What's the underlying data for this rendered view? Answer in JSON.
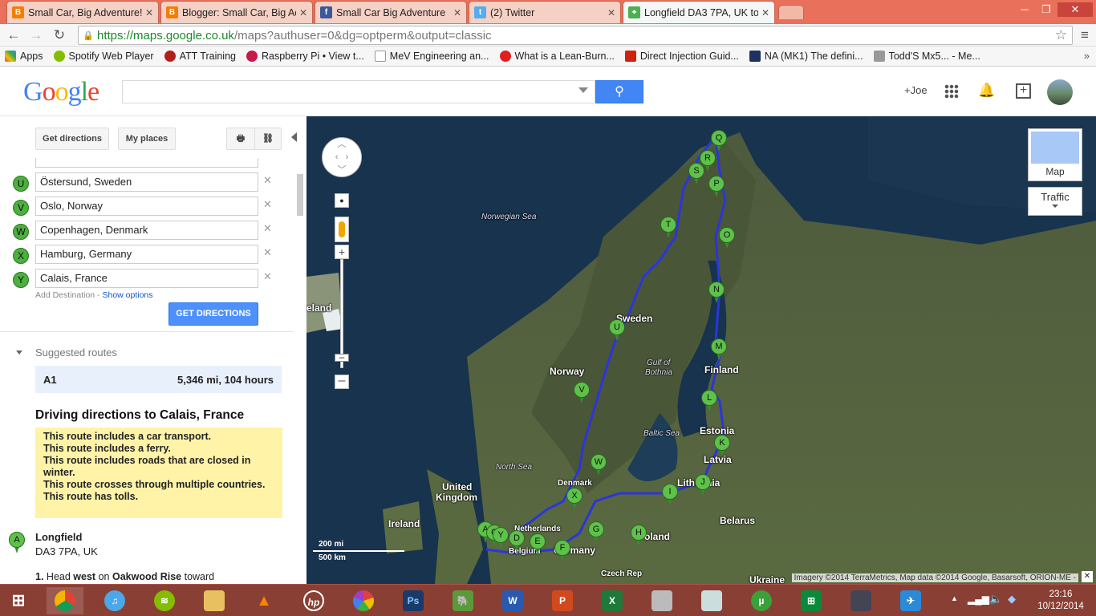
{
  "browser": {
    "tabs": [
      {
        "title": "Small Car, Big Adventure!",
        "favicon": "blogger-icon",
        "color": "#f57d00"
      },
      {
        "title": "Blogger: Small Car, Big Ad",
        "favicon": "blogger-icon",
        "color": "#f57d00"
      },
      {
        "title": "Small Car Big Adventure",
        "favicon": "facebook-icon",
        "color": "#3b5998"
      },
      {
        "title": "(2) Twitter",
        "favicon": "twitter-icon",
        "color": "#55acee"
      },
      {
        "title": "Longfield DA3 7PA, UK to",
        "favicon": "maps-icon",
        "color": "#4caf50"
      }
    ],
    "url_host": "https://maps.google.co.uk",
    "url_path": "/maps?authuser=0&dg=optperm&output=classic",
    "bookmarks": [
      {
        "label": "Apps",
        "color": "#e94235"
      },
      {
        "label": "Spotify Web Player",
        "color": "#84bd00"
      },
      {
        "label": "ATT Training",
        "color": "#b0201a"
      },
      {
        "label": "Raspberry Pi • View t...",
        "color": "#c51a4a"
      },
      {
        "label": "MeV Engineering an...",
        "color": "#ffffff"
      },
      {
        "label": "What is a Lean-Burn...",
        "color": "#e02020"
      },
      {
        "label": "Direct Injection Guid...",
        "color": "#d02010"
      },
      {
        "label": "NA (MK1) The defini...",
        "color": "#203060"
      },
      {
        "label": "Todd'S Mx5... - Me...",
        "color": "#999999"
      }
    ]
  },
  "google": {
    "logo": "Google",
    "user": "+Joe",
    "search_value": ""
  },
  "panel": {
    "get_directions_tab": "Get directions",
    "my_places_tab": "My places",
    "destinations": [
      {
        "letter": "U",
        "value": "Östersund, Sweden"
      },
      {
        "letter": "V",
        "value": "Oslo, Norway"
      },
      {
        "letter": "W",
        "value": "Copenhagen, Denmark"
      },
      {
        "letter": "X",
        "value": "Hamburg, Germany"
      },
      {
        "letter": "Y",
        "value": "Calais, France"
      }
    ],
    "add_destination": "Add Destination",
    "show_options": "Show options",
    "get_directions_button": "GET DIRECTIONS",
    "suggested_routes_label": "Suggested routes",
    "route_name": "A1",
    "route_summary": "5,346 mi, 104 hours",
    "directions_title": "Driving directions to Calais, France",
    "warnings": [
      "This route includes a car transport.",
      "This route includes a ferry.",
      "This route includes roads that are closed in winter.",
      "This route crosses through multiple countries.",
      "This route has tolls."
    ],
    "start_letter": "A",
    "start_name": "Longfield",
    "start_address": "DA3 7PA, UK",
    "step1_num": "1.",
    "step1_a": "Head",
    "step1_dir": "west",
    "step1_b": "on",
    "step1_road": "Oakwood Rise",
    "step1_c": "toward"
  },
  "map": {
    "map_button": "Map",
    "traffic_button": "Traffic",
    "scale_mi": "200 mi",
    "scale_km": "500 km",
    "attribution": "Imagery ©2014 TerraMetrics, Map data ©2014 Google, Basarsoft, ORION-ME -",
    "labels": [
      {
        "text": "Norwegian Sea",
        "kind": "sea"
      },
      {
        "text": "eland",
        "kind": "land"
      },
      {
        "text": "Sweden",
        "kind": "land"
      },
      {
        "text": "Gulf of",
        "kind": "sea"
      },
      {
        "text": "Bothnia",
        "kind": "sea"
      },
      {
        "text": "Finland",
        "kind": "land"
      },
      {
        "text": "Norway",
        "kind": "land"
      },
      {
        "text": "Estonia",
        "kind": "land"
      },
      {
        "text": "Baltic Sea",
        "kind": "sea"
      },
      {
        "text": "North Sea",
        "kind": "sea"
      },
      {
        "text": "Latvia",
        "kind": "land"
      },
      {
        "text": "Denmark",
        "kind": "land"
      },
      {
        "text": "Lithuania",
        "kind": "land"
      },
      {
        "text": "United",
        "kind": "land"
      },
      {
        "text": "Kingdom",
        "kind": "land"
      },
      {
        "text": "Ireland",
        "kind": "land"
      },
      {
        "text": "Netherlands",
        "kind": "land"
      },
      {
        "text": "Belarus",
        "kind": "land"
      },
      {
        "text": "Poland",
        "kind": "land"
      },
      {
        "text": "Germany",
        "kind": "land"
      },
      {
        "text": "Belgium",
        "kind": "land"
      },
      {
        "text": "Czech Rep",
        "kind": "land"
      },
      {
        "text": "Ukraine",
        "kind": "land"
      }
    ],
    "markers": [
      "Q",
      "R",
      "S",
      "P",
      "T",
      "O",
      "N",
      "U",
      "M",
      "V",
      "L",
      "K",
      "W",
      "J",
      "I",
      "X",
      "G",
      "H",
      "A",
      "C",
      "Y",
      "D",
      "E",
      "F"
    ]
  },
  "taskbar": {
    "clock_time": "23:16",
    "clock_date": "10/12/2014",
    "apps": [
      "chrome-icon",
      "itunes-icon",
      "spotify-icon",
      "file-explorer-icon",
      "vlc-icon",
      "hp-icon",
      "picasa-icon",
      "photoshop-icon",
      "evernote-icon",
      "word-icon",
      "powerpoint-icon",
      "excel-icon",
      "device-icon",
      "monitor-icon",
      "utorrent-icon",
      "store-icon",
      "app-icon",
      "flight-icon"
    ]
  }
}
